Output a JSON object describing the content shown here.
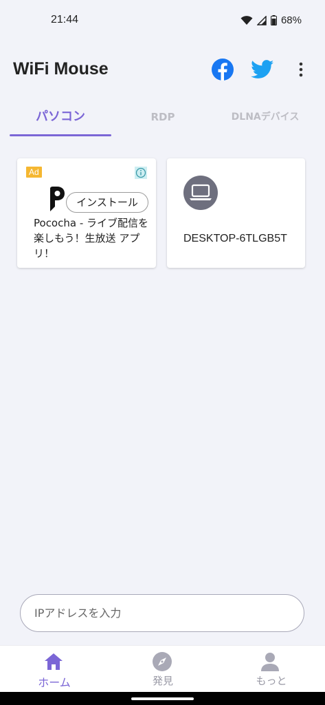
{
  "status_bar": {
    "time": "21:44",
    "battery": "68%"
  },
  "app_bar": {
    "title": "WiFi Mouse",
    "icons": [
      "facebook-icon",
      "twitter-icon",
      "more-vert-icon"
    ]
  },
  "tabs": [
    {
      "label": "パソコン",
      "selected": true
    },
    {
      "label": "RDP",
      "selected": false
    },
    {
      "label": "DLNAデバイス",
      "selected": false
    }
  ],
  "ad_card": {
    "badge": "Ad",
    "install_label": "インストール",
    "text": "Pococha - ライブ配信を楽しもう！生放送 アプリ！"
  },
  "computer_card": {
    "name": "DESKTOP-6TLGB5T"
  },
  "ip_input": {
    "placeholder": "IPアドレスを入力",
    "value": ""
  },
  "bottom_nav": [
    {
      "label": "ホーム",
      "icon": "home-icon",
      "selected": true
    },
    {
      "label": "発見",
      "icon": "compass-icon",
      "selected": false
    },
    {
      "label": "もっと",
      "icon": "person-icon",
      "selected": false
    }
  ],
  "colors": {
    "accent": "#7b66d6",
    "background": "#f2f3f9",
    "facebook": "#1877f2",
    "twitter": "#1da1f2",
    "ad_badge": "#f5b731"
  }
}
